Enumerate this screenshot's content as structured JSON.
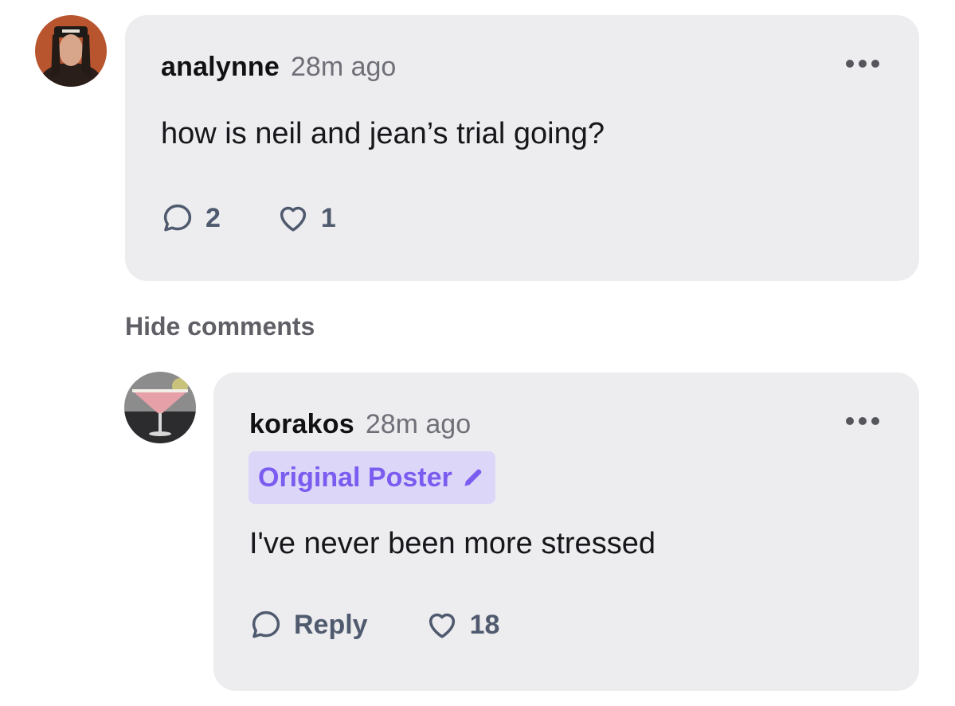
{
  "comments": [
    {
      "username": "analynne",
      "time": "28m ago",
      "text": "how is neil and jean’s trial going?",
      "reply_count": "2",
      "like_count": "1",
      "avatar_icon": "profile-photo"
    }
  ],
  "hide_comments_label": "Hide comments",
  "replies": [
    {
      "username": "korakos",
      "time": "28m ago",
      "badge": "Original Poster",
      "badge_icon": "pencil-icon",
      "text": "I've never been more stressed",
      "reply_label": "Reply",
      "like_count": "18",
      "avatar_icon": "cocktail-photo"
    }
  ],
  "colors": {
    "card_background": "#ededf0",
    "badge_background": "#dcd6f8",
    "badge_text": "#7b5cf0",
    "action_text": "#4f5a6e",
    "muted_text": "#6f6f78"
  }
}
